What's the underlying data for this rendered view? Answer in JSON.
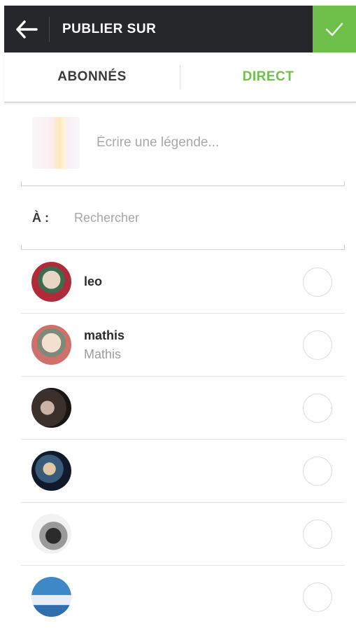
{
  "header": {
    "title": "PUBLIER SUR",
    "colors": {
      "bar": "#26272b",
      "confirm": "#6fbf4b"
    }
  },
  "tabs": [
    {
      "label": "ABONNÉS",
      "active": false
    },
    {
      "label": "DIRECT",
      "active": true
    }
  ],
  "caption": {
    "placeholder": "Écrire une légende...",
    "value": ""
  },
  "search": {
    "label": "À :",
    "placeholder": "Rechercher",
    "value": ""
  },
  "contacts": [
    {
      "username": "leo",
      "full_name": ""
    },
    {
      "username": "mathis",
      "full_name": "Mathis"
    },
    {
      "username": "",
      "full_name": ""
    },
    {
      "username": "",
      "full_name": ""
    },
    {
      "username": "",
      "full_name": ""
    },
    {
      "username": "",
      "full_name": ""
    }
  ]
}
